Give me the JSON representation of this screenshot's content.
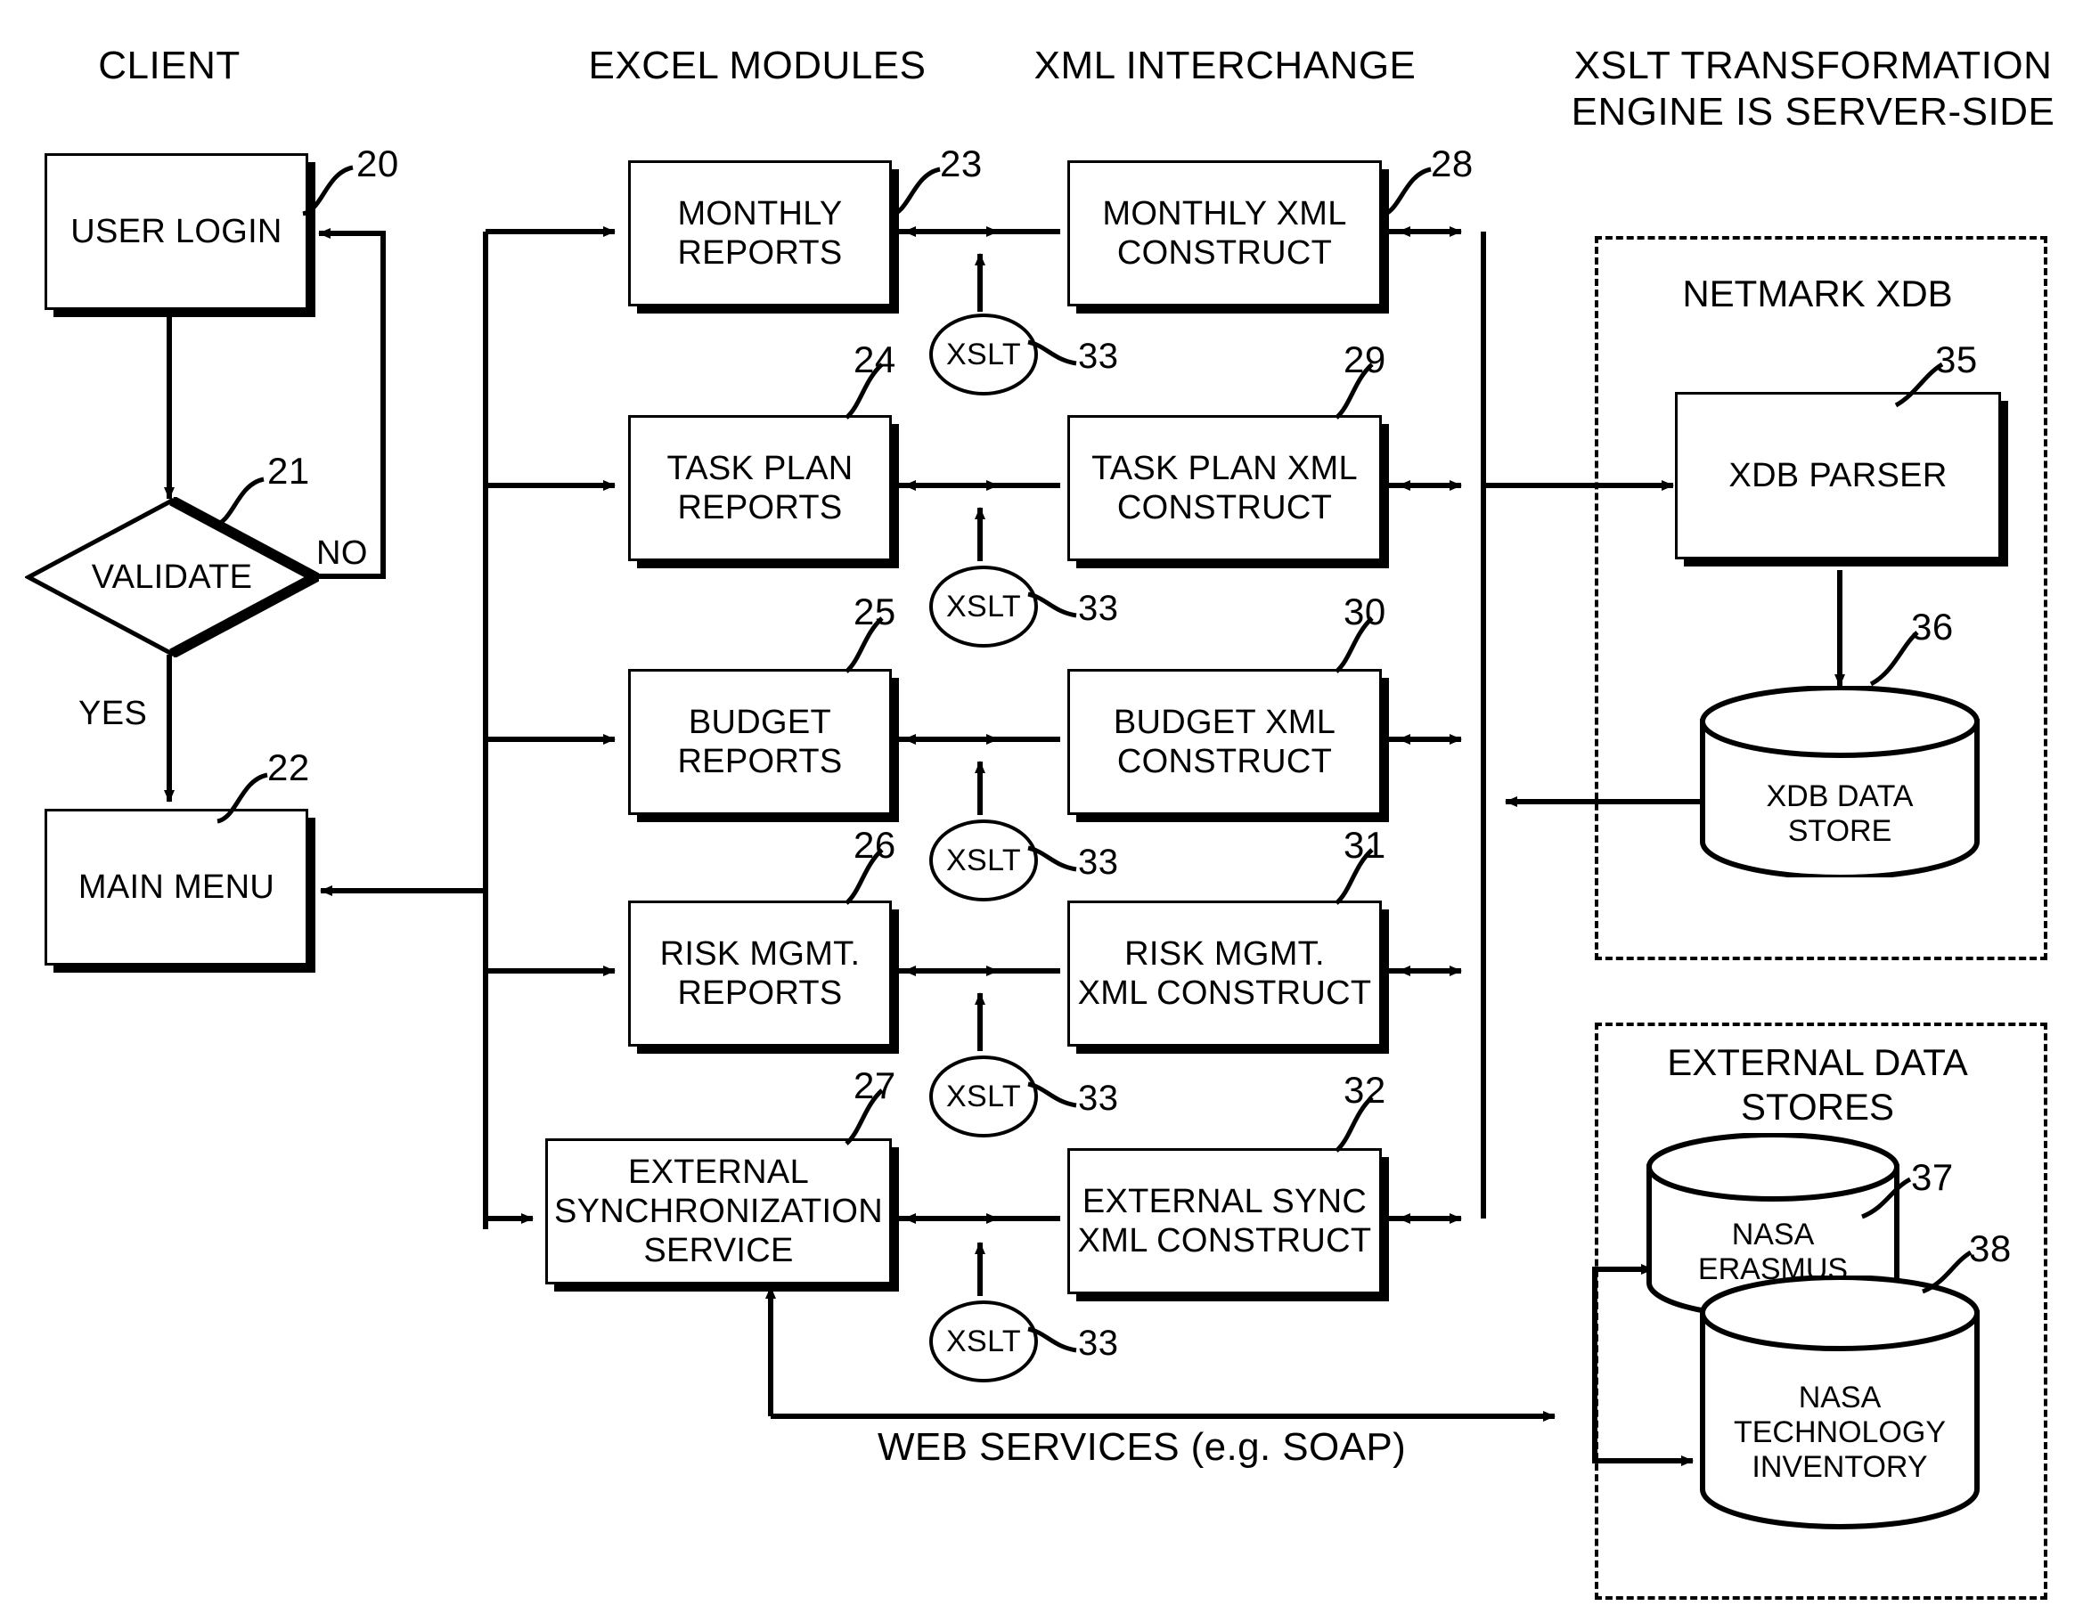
{
  "columns": {
    "client": "CLIENT",
    "excel_modules": "EXCEL MODULES",
    "xml_interchange": "XML INTERCHANGE",
    "xslt_engine": "XSLT TRANSFORMATION\nENGINE IS SERVER-SIDE"
  },
  "client_flow": {
    "user_login": {
      "label": "USER LOGIN",
      "ref": "20"
    },
    "validate": {
      "label": "VALIDATE",
      "ref": "21"
    },
    "main_menu": {
      "label": "MAIN MENU",
      "ref": "22"
    },
    "branch_no": "NO",
    "branch_yes": "YES"
  },
  "excel_modules": [
    {
      "label": "MONTHLY\nREPORTS",
      "ref": "23"
    },
    {
      "label": "TASK PLAN\nREPORTS",
      "ref": "24"
    },
    {
      "label": "BUDGET\nREPORTS",
      "ref": "25"
    },
    {
      "label": "RISK MGMT.\nREPORTS",
      "ref": "26"
    },
    {
      "label": "EXTERNAL\nSYNCHRONIZATION\nSERVICE",
      "ref": "27"
    }
  ],
  "xml_constructs": [
    {
      "label": "MONTHLY XML\nCONSTRUCT",
      "ref": "28"
    },
    {
      "label": "TASK PLAN XML\nCONSTRUCT",
      "ref": "29"
    },
    {
      "label": "BUDGET XML\nCONSTRUCT",
      "ref": "30"
    },
    {
      "label": "RISK MGMT.\nXML CONSTRUCT",
      "ref": "31"
    },
    {
      "label": "EXTERNAL SYNC\nXML CONSTRUCT",
      "ref": "32"
    }
  ],
  "xslt_nodes": [
    {
      "label": "XSLT",
      "ref": "33"
    },
    {
      "label": "XSLT",
      "ref": "33"
    },
    {
      "label": "XSLT",
      "ref": "33"
    },
    {
      "label": "XSLT",
      "ref": "33"
    },
    {
      "label": "XSLT",
      "ref": "33"
    }
  ],
  "netmark": {
    "title": "NETMARK XDB",
    "parser": {
      "label": "XDB PARSER",
      "ref": "35"
    },
    "store": {
      "label": "XDB DATA\nSTORE",
      "ref": "36"
    }
  },
  "external_data_stores": {
    "title": "EXTERNAL DATA\nSTORES",
    "stores": [
      {
        "label": "NASA\nERASMUS",
        "ref": "37"
      },
      {
        "label": "NASA\nTECHNOLOGY\nINVENTORY",
        "ref": "38"
      }
    ]
  },
  "web_services_label": "WEB SERVICES (e.g. SOAP)",
  "colors": {
    "ink": "#000000",
    "paper": "#ffffff"
  }
}
